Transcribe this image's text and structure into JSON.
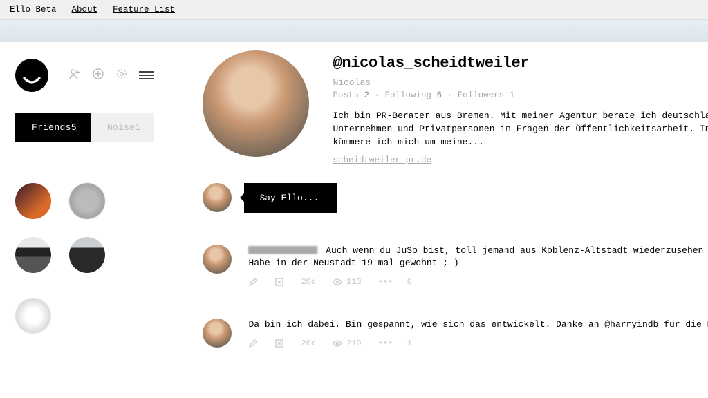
{
  "topbar": {
    "brand": "Ello Beta",
    "about": "About",
    "features": "Feature List"
  },
  "sidebar": {
    "tabs": {
      "friends_label": "Friends",
      "friends_count": "5",
      "noise_label": "Noise",
      "noise_count": "1"
    }
  },
  "profile": {
    "handle": "@nicolas_scheidtweiler",
    "name": "Nicolas",
    "posts_label": "Posts",
    "posts_count": "2",
    "following_label": "Following",
    "following_count": "6",
    "followers_label": "Followers",
    "followers_count": "1",
    "bio_line1": "Ich bin PR-Berater aus Bremen. Mit meiner Agentur berate ich deutschla",
    "bio_line2": "Unternehmen und Privatpersonen in Fragen der Öffentlichkeitsarbeit. In",
    "bio_line3": "kümmere ich mich um meine...",
    "site": "scheidtweiler-pr.de"
  },
  "composer": {
    "placeholder": "Say Ello..."
  },
  "posts": [
    {
      "text_line1_tail": " Auch wenn du JuSo bist, toll jemand aus Koblenz-Altstadt wiederzusehen",
      "text_line2": "Habe in der Neustadt 19 mal gewohnt ;-)",
      "age": "20d",
      "views": "113",
      "replies": "0"
    },
    {
      "text_line1": "Da bin ich dabei. Bin gespannt, wie sich das entwickelt. Danke an ",
      "mention": "@harryindb",
      "text_line1_tail": " für die E",
      "age": "20d",
      "views": "219",
      "replies": "1"
    }
  ]
}
